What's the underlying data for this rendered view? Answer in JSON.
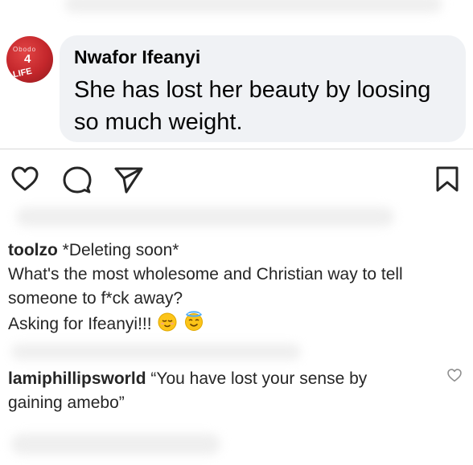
{
  "fb_comment": {
    "author": "Nwafor Ifeanyi",
    "text": "She has lost her beauty by loosing so much weight.",
    "avatar": {
      "top_text": "Obodo",
      "number": "4",
      "bottom_text": "LIFE"
    }
  },
  "comments": [
    {
      "username": "toolzo",
      "lines": [
        "*Deleting soon*",
        "What's the most wholesome and Christian way to tell",
        "someone to f*ck away?",
        "Asking for Ifeanyi!!!"
      ],
      "emojis": [
        "relieved-face",
        "smiling-face-with-halo"
      ]
    },
    {
      "username": "lamiphillipsworld",
      "lines": [
        "“You have lost your sense by",
        "gaining amebo”"
      ]
    }
  ],
  "icons": {
    "like": "heart-icon",
    "comment": "comment-bubble-icon",
    "share": "paper-plane-icon",
    "save": "bookmark-icon",
    "comment_like": "heart-icon"
  },
  "colors": {
    "bubble_bg": "#f0f2f5",
    "avatar_red": "#c3262b",
    "text": "#262626"
  }
}
